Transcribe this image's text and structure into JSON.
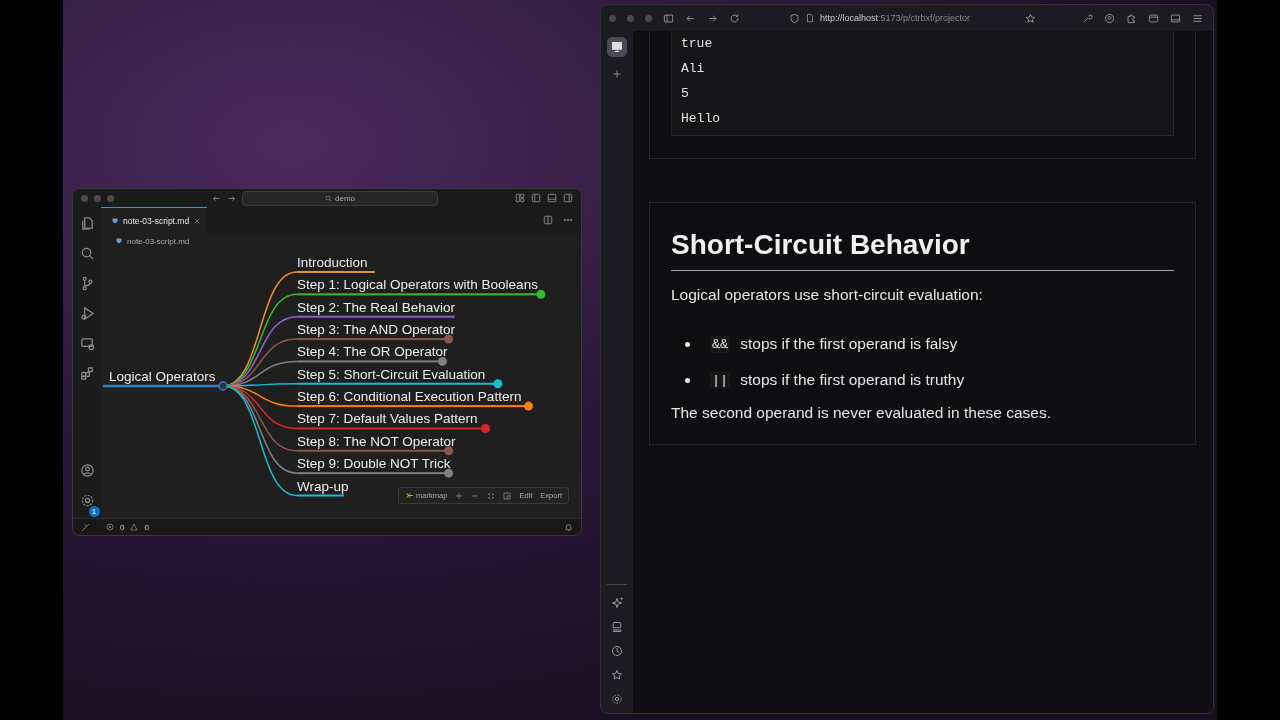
{
  "editor": {
    "search": "demo",
    "tabs": [
      {
        "label": "note-03-script.md",
        "selected": true
      }
    ],
    "breadcrumb": "note-03-script.md",
    "mindmap": {
      "label": "Logical Operators",
      "color": "#2f7fc1",
      "children": [
        {
          "label": "Introduction",
          "color": "#e8913a",
          "collapsed": false
        },
        {
          "label": "Step 1: Logical Operators with Booleans",
          "color": "#3cb832",
          "collapsed": true
        },
        {
          "label": "Step 2: The Real Behavior",
          "color": "#8a63c9",
          "collapsed": false
        },
        {
          "label": "Step 3: The AND Operator",
          "color": "#8c564b",
          "collapsed": true
        },
        {
          "label": "Step 4: The OR Operator",
          "color": "#7f7f7f",
          "collapsed": true
        },
        {
          "label": "Step 5: Short-Circuit Evaluation",
          "color": "#17becf",
          "collapsed": true
        },
        {
          "label": "Step 6: Conditional Execution Pattern",
          "color": "#ff7f0e",
          "collapsed": true
        },
        {
          "label": "Step 7: Default Values Pattern",
          "color": "#d62728",
          "collapsed": true
        },
        {
          "label": "Step 8: The NOT Operator",
          "color": "#8c564b",
          "collapsed": true
        },
        {
          "label": "Step 9: Double NOT Trick",
          "color": "#7f7f7f",
          "collapsed": true
        },
        {
          "label": "Wrap-up",
          "color": "#17becf",
          "collapsed": false
        }
      ]
    },
    "toolbar": {
      "brand": "markmap",
      "buttons": [
        "Edit",
        "Export"
      ]
    },
    "settings_badge": "1",
    "status": {
      "errors": "0",
      "warnings": "0"
    }
  },
  "browser": {
    "url_host": "http://localhost",
    "url_rest": ":5173/p/ctrbxf/projector",
    "output_lines": [
      "true",
      "Ali",
      "5",
      "Hello"
    ],
    "section": {
      "title": "Short-Circuit Behavior",
      "intro": "Logical operators use short-circuit evaluation:",
      "bullets": [
        {
          "code": "&&",
          "text": "stops if the first operand is falsy"
        },
        {
          "code": "||",
          "text": "stops if the first operand is truthy"
        }
      ],
      "closing": "The second operand is never evaluated in these cases."
    }
  }
}
